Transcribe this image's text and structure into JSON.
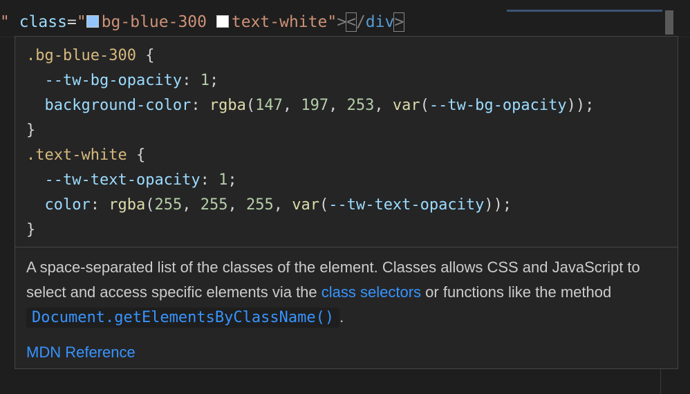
{
  "editor": {
    "line_quote_open": "\"",
    "attr_name": "class",
    "equals": "=",
    "value_open_quote": "\"",
    "class1": "bg-blue-300",
    "class1_swatch_color": "#93c5fd",
    "space": " ",
    "class2": "text-white",
    "class2_swatch_color": "#ffffff",
    "value_close_quote": "\"",
    "tag_close": ">",
    "end_tag_open": "<",
    "end_tag_slash": "/",
    "end_tag_name": "div",
    "end_tag_close": ">"
  },
  "hover": {
    "rules": [
      {
        "selector": ".bg-blue-300",
        "open": " {",
        "decls": [
          {
            "prop": "--tw-bg-opacity",
            "parts": [
              {
                "t": "num",
                "v": "1"
              }
            ]
          },
          {
            "prop": "background-color",
            "parts": [
              {
                "t": "fn",
                "v": "rgba"
              },
              {
                "t": "p",
                "v": "("
              },
              {
                "t": "num",
                "v": "147"
              },
              {
                "t": "p",
                "v": ", "
              },
              {
                "t": "num",
                "v": "197"
              },
              {
                "t": "p",
                "v": ", "
              },
              {
                "t": "num",
                "v": "253"
              },
              {
                "t": "p",
                "v": ", "
              },
              {
                "t": "fn",
                "v": "var"
              },
              {
                "t": "p",
                "v": "("
              },
              {
                "t": "prop",
                "v": "--tw-bg-opacity"
              },
              {
                "t": "p",
                "v": "))"
              }
            ]
          }
        ],
        "close": "}"
      },
      {
        "selector": ".text-white",
        "open": " {",
        "decls": [
          {
            "prop": "--tw-text-opacity",
            "parts": [
              {
                "t": "num",
                "v": "1"
              }
            ]
          },
          {
            "prop": "color",
            "parts": [
              {
                "t": "fn",
                "v": "rgba"
              },
              {
                "t": "p",
                "v": "("
              },
              {
                "t": "num",
                "v": "255"
              },
              {
                "t": "p",
                "v": ", "
              },
              {
                "t": "num",
                "v": "255"
              },
              {
                "t": "p",
                "v": ", "
              },
              {
                "t": "num",
                "v": "255"
              },
              {
                "t": "p",
                "v": ", "
              },
              {
                "t": "fn",
                "v": "var"
              },
              {
                "t": "p",
                "v": "("
              },
              {
                "t": "prop",
                "v": "--tw-text-opacity"
              },
              {
                "t": "p",
                "v": "))"
              }
            ]
          }
        ],
        "close": "}"
      }
    ],
    "description": {
      "text_before_link": "A space-separated list of the classes of the element. Classes allows CSS and JavaScript to select and access specific elements via the ",
      "link_text": "class selectors",
      "text_after_link": " or functions like the method ",
      "code_text": "Document.getElementsByClassName()",
      "text_end": "."
    },
    "reference_link": "MDN Reference"
  },
  "colors": {
    "editor_bg": "#1e1e1e",
    "hover_bg": "#252526",
    "link": "#3794ff",
    "selector": "#d7ba7d",
    "property": "#9cdcfe",
    "number": "#b5cea8",
    "function": "#dcdcaa",
    "string": "#ce9178"
  }
}
